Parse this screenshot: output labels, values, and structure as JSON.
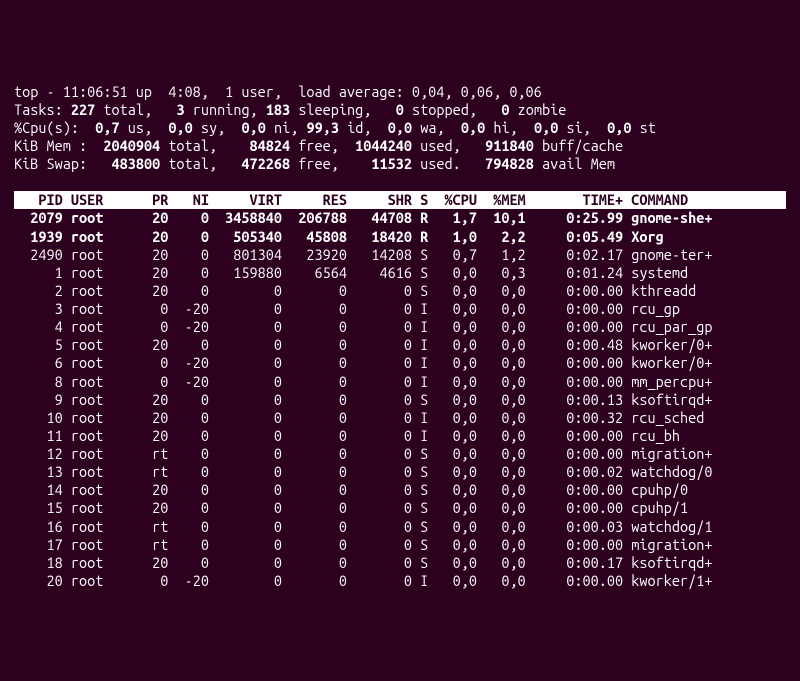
{
  "header": {
    "line1": "top - 11:06:51 up  4:08,  1 user,  load average: 0,04, 0,06, 0,06",
    "tasks": {
      "label": "Tasks:",
      "total": "227",
      "total_lbl": "total,",
      "running": "3",
      "running_lbl": "running,",
      "sleeping": "183",
      "sleeping_lbl": "sleeping,",
      "stopped": "0",
      "stopped_lbl": "stopped,",
      "zombie": "0",
      "zombie_lbl": "zombie"
    },
    "cpu": {
      "label": "%Cpu(s):",
      "us": "0,7",
      "us_lbl": "us,",
      "sy": "0,0",
      "sy_lbl": "sy,",
      "ni": "0,0",
      "ni_lbl": "ni,",
      "id": "99,3",
      "id_lbl": "id,",
      "wa": "0,0",
      "wa_lbl": "wa,",
      "hi": "0,0",
      "hi_lbl": "hi,",
      "si": "0,0",
      "si_lbl": "si,",
      "st": "0,0",
      "st_lbl": "st"
    },
    "mem": {
      "label": "KiB Mem :",
      "total": "2040904",
      "total_lbl": "total,",
      "free": "84824",
      "free_lbl": "free,",
      "used": "1044240",
      "used_lbl": "used,",
      "buff": "911840",
      "buff_lbl": "buff/cache"
    },
    "swap": {
      "label": "KiB Swap:",
      "total": "483800",
      "total_lbl": "total,",
      "free": "472268",
      "free_lbl": "free,",
      "used": "11532",
      "used_lbl": "used.",
      "avail": "794828",
      "avail_lbl": "avail Mem"
    }
  },
  "columns": {
    "pid": "PID",
    "user": "USER",
    "pr": "PR",
    "ni": "NI",
    "virt": "VIRT",
    "res": "RES",
    "shr": "SHR",
    "s": "S",
    "cpu": "%CPU",
    "mem": "%MEM",
    "time": "TIME+",
    "cmd": "COMMAND"
  },
  "rows": [
    {
      "pid": "2079",
      "user": "root",
      "pr": "20",
      "ni": "0",
      "virt": "3458840",
      "res": "206788",
      "shr": "44708",
      "s": "R",
      "cpu": "1,7",
      "mem": "10,1",
      "time": "0:25.99",
      "cmd": "gnome-she+",
      "bold": true
    },
    {
      "pid": "1939",
      "user": "root",
      "pr": "20",
      "ni": "0",
      "virt": "505340",
      "res": "45808",
      "shr": "18420",
      "s": "R",
      "cpu": "1,0",
      "mem": "2,2",
      "time": "0:05.49",
      "cmd": "Xorg",
      "bold": true
    },
    {
      "pid": "2490",
      "user": "root",
      "pr": "20",
      "ni": "0",
      "virt": "801304",
      "res": "23920",
      "shr": "14208",
      "s": "S",
      "cpu": "0,7",
      "mem": "1,2",
      "time": "0:02.17",
      "cmd": "gnome-ter+"
    },
    {
      "pid": "1",
      "user": "root",
      "pr": "20",
      "ni": "0",
      "virt": "159880",
      "res": "6564",
      "shr": "4616",
      "s": "S",
      "cpu": "0,0",
      "mem": "0,3",
      "time": "0:01.24",
      "cmd": "systemd"
    },
    {
      "pid": "2",
      "user": "root",
      "pr": "20",
      "ni": "0",
      "virt": "0",
      "res": "0",
      "shr": "0",
      "s": "S",
      "cpu": "0,0",
      "mem": "0,0",
      "time": "0:00.00",
      "cmd": "kthreadd"
    },
    {
      "pid": "3",
      "user": "root",
      "pr": "0",
      "ni": "-20",
      "virt": "0",
      "res": "0",
      "shr": "0",
      "s": "I",
      "cpu": "0,0",
      "mem": "0,0",
      "time": "0:00.00",
      "cmd": "rcu_gp"
    },
    {
      "pid": "4",
      "user": "root",
      "pr": "0",
      "ni": "-20",
      "virt": "0",
      "res": "0",
      "shr": "0",
      "s": "I",
      "cpu": "0,0",
      "mem": "0,0",
      "time": "0:00.00",
      "cmd": "rcu_par_gp"
    },
    {
      "pid": "5",
      "user": "root",
      "pr": "20",
      "ni": "0",
      "virt": "0",
      "res": "0",
      "shr": "0",
      "s": "I",
      "cpu": "0,0",
      "mem": "0,0",
      "time": "0:00.48",
      "cmd": "kworker/0+"
    },
    {
      "pid": "6",
      "user": "root",
      "pr": "0",
      "ni": "-20",
      "virt": "0",
      "res": "0",
      "shr": "0",
      "s": "I",
      "cpu": "0,0",
      "mem": "0,0",
      "time": "0:00.00",
      "cmd": "kworker/0+"
    },
    {
      "pid": "8",
      "user": "root",
      "pr": "0",
      "ni": "-20",
      "virt": "0",
      "res": "0",
      "shr": "0",
      "s": "I",
      "cpu": "0,0",
      "mem": "0,0",
      "time": "0:00.00",
      "cmd": "mm_percpu+"
    },
    {
      "pid": "9",
      "user": "root",
      "pr": "20",
      "ni": "0",
      "virt": "0",
      "res": "0",
      "shr": "0",
      "s": "S",
      "cpu": "0,0",
      "mem": "0,0",
      "time": "0:00.13",
      "cmd": "ksoftirqd+"
    },
    {
      "pid": "10",
      "user": "root",
      "pr": "20",
      "ni": "0",
      "virt": "0",
      "res": "0",
      "shr": "0",
      "s": "I",
      "cpu": "0,0",
      "mem": "0,0",
      "time": "0:00.32",
      "cmd": "rcu_sched"
    },
    {
      "pid": "11",
      "user": "root",
      "pr": "20",
      "ni": "0",
      "virt": "0",
      "res": "0",
      "shr": "0",
      "s": "I",
      "cpu": "0,0",
      "mem": "0,0",
      "time": "0:00.00",
      "cmd": "rcu_bh"
    },
    {
      "pid": "12",
      "user": "root",
      "pr": "rt",
      "ni": "0",
      "virt": "0",
      "res": "0",
      "shr": "0",
      "s": "S",
      "cpu": "0,0",
      "mem": "0,0",
      "time": "0:00.00",
      "cmd": "migration+"
    },
    {
      "pid": "13",
      "user": "root",
      "pr": "rt",
      "ni": "0",
      "virt": "0",
      "res": "0",
      "shr": "0",
      "s": "S",
      "cpu": "0,0",
      "mem": "0,0",
      "time": "0:00.02",
      "cmd": "watchdog/0"
    },
    {
      "pid": "14",
      "user": "root",
      "pr": "20",
      "ni": "0",
      "virt": "0",
      "res": "0",
      "shr": "0",
      "s": "S",
      "cpu": "0,0",
      "mem": "0,0",
      "time": "0:00.00",
      "cmd": "cpuhp/0"
    },
    {
      "pid": "15",
      "user": "root",
      "pr": "20",
      "ni": "0",
      "virt": "0",
      "res": "0",
      "shr": "0",
      "s": "S",
      "cpu": "0,0",
      "mem": "0,0",
      "time": "0:00.00",
      "cmd": "cpuhp/1"
    },
    {
      "pid": "16",
      "user": "root",
      "pr": "rt",
      "ni": "0",
      "virt": "0",
      "res": "0",
      "shr": "0",
      "s": "S",
      "cpu": "0,0",
      "mem": "0,0",
      "time": "0:00.03",
      "cmd": "watchdog/1"
    },
    {
      "pid": "17",
      "user": "root",
      "pr": "rt",
      "ni": "0",
      "virt": "0",
      "res": "0",
      "shr": "0",
      "s": "S",
      "cpu": "0,0",
      "mem": "0,0",
      "time": "0:00.00",
      "cmd": "migration+"
    },
    {
      "pid": "18",
      "user": "root",
      "pr": "20",
      "ni": "0",
      "virt": "0",
      "res": "0",
      "shr": "0",
      "s": "S",
      "cpu": "0,0",
      "mem": "0,0",
      "time": "0:00.17",
      "cmd": "ksoftirqd+"
    },
    {
      "pid": "20",
      "user": "root",
      "pr": "0",
      "ni": "-20",
      "virt": "0",
      "res": "0",
      "shr": "0",
      "s": "I",
      "cpu": "0,0",
      "mem": "0,0",
      "time": "0:00.00",
      "cmd": "kworker/1+"
    }
  ]
}
